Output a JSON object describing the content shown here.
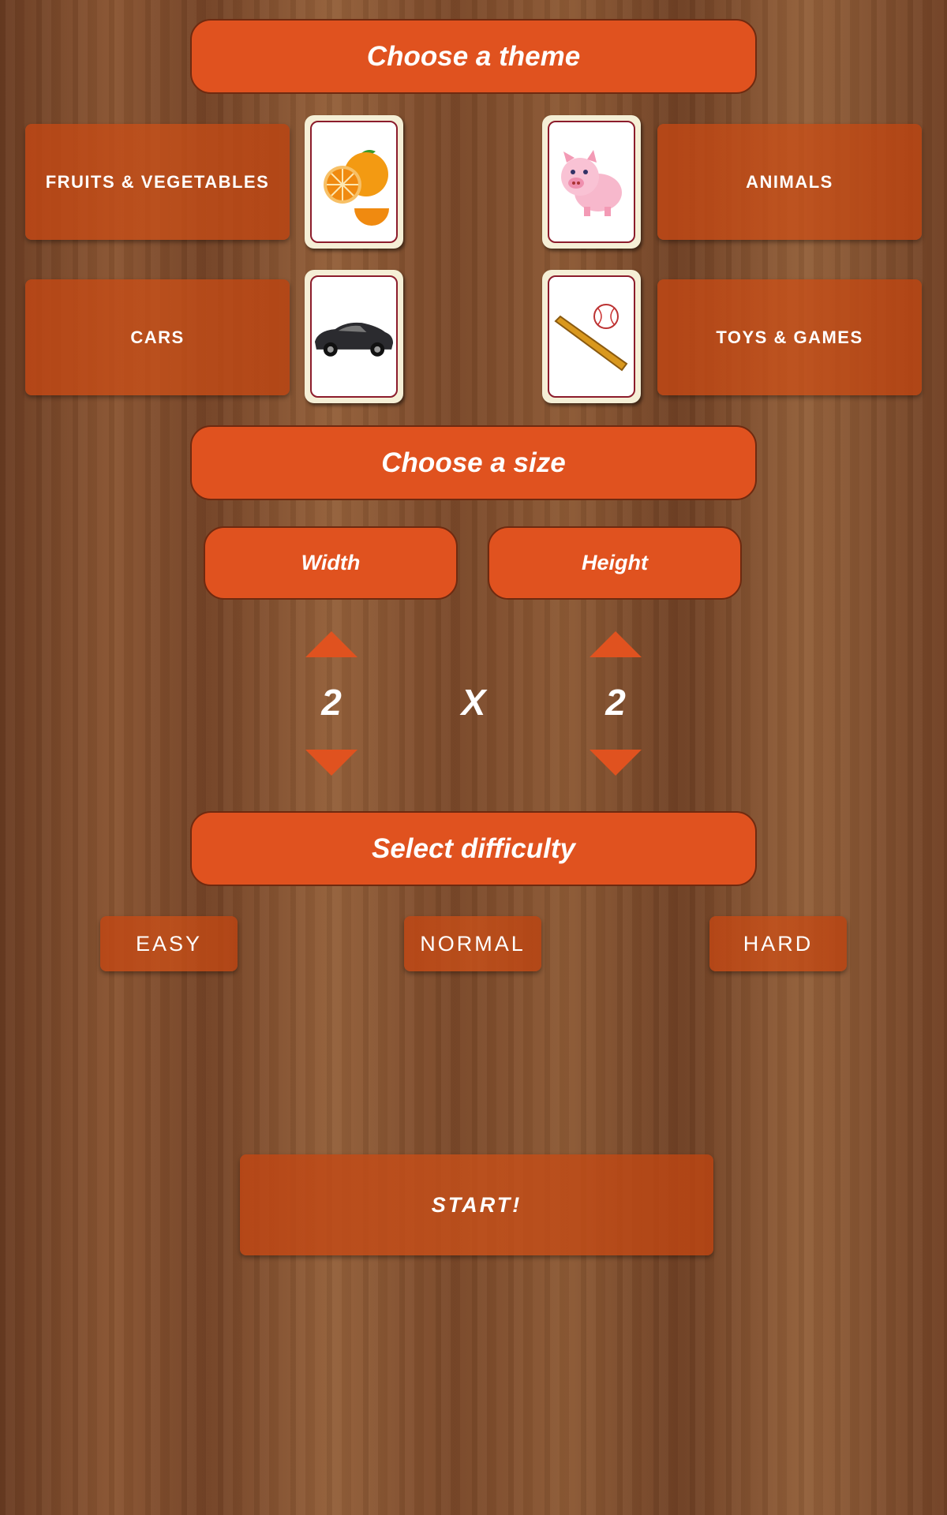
{
  "theme_header": "Choose a theme",
  "themes": [
    {
      "label": "FRUITS & VEGETABLES",
      "icon": "orange-icon"
    },
    {
      "label": "ANIMALS",
      "icon": "pig-icon"
    },
    {
      "label": "CARS",
      "icon": "car-icon"
    },
    {
      "label": "TOYS & GAMES",
      "icon": "baseball-bat-icon"
    }
  ],
  "size_header": "Choose a size",
  "size": {
    "width_label": "Width",
    "height_label": "Height",
    "width_value": "2",
    "height_value": "2",
    "separator": "X"
  },
  "difficulty_header": "Select difficulty",
  "difficulty": [
    "EASY",
    "NORMAL",
    "HARD"
  ],
  "start_label": "START!",
  "colors": {
    "accent": "#e0521f",
    "button_wood": "#c0481a",
    "card_border": "#8c1c2c"
  }
}
